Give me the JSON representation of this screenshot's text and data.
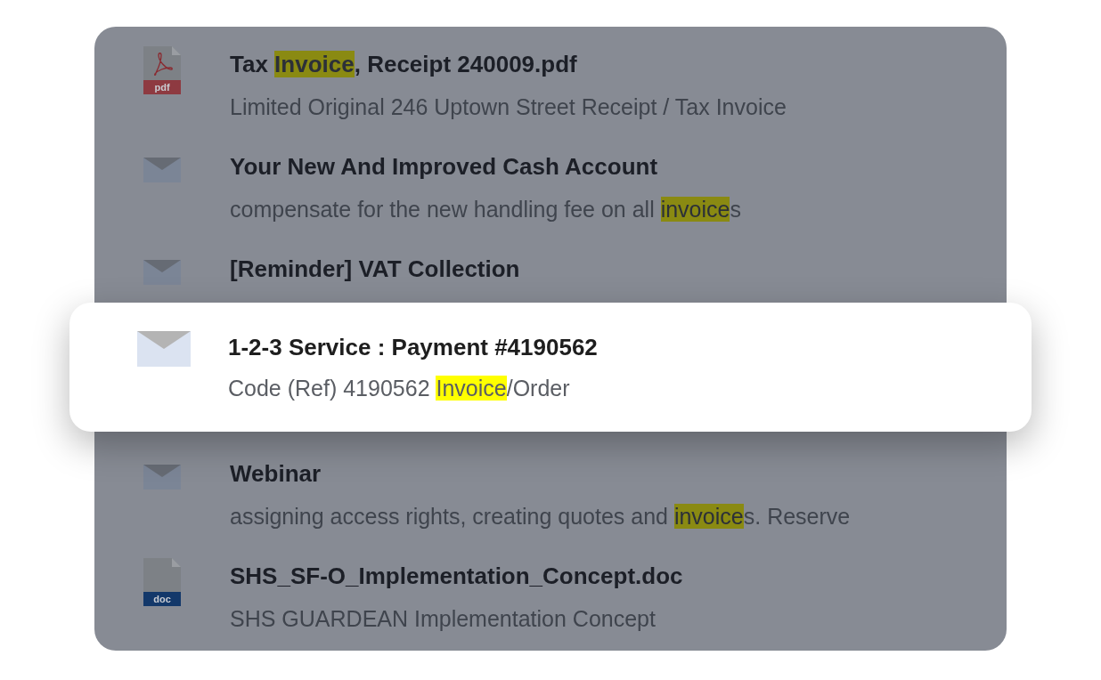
{
  "results": [
    {
      "kind": "pdf",
      "badge": "pdf",
      "title": [
        {
          "text": "Tax "
        },
        {
          "text": "Invoice",
          "highlighted": true
        },
        {
          "text": ", Receipt 240009.pdf"
        }
      ],
      "snippet": [
        {
          "text": "Limited Original 246 Uptown Street Receipt / Tax Invoice"
        }
      ]
    },
    {
      "kind": "mail",
      "title": [
        {
          "text": "Your New And Improved Cash Account"
        }
      ],
      "snippet": [
        {
          "text": "compensate for the new handling fee on all "
        },
        {
          "text": "invoice",
          "highlighted": true
        },
        {
          "text": "s"
        }
      ]
    },
    {
      "kind": "mail",
      "title": [
        {
          "text": "[Reminder] VAT Collection"
        }
      ]
    },
    {
      "kind": "mail",
      "selected": true,
      "title": [
        {
          "text": "1-2-3 Service : Payment #4190562"
        }
      ],
      "snippet": [
        {
          "text": "Code (Ref) 4190562 "
        },
        {
          "text": "Invoice",
          "highlighted": true
        },
        {
          "text": "/Order"
        }
      ]
    },
    {
      "kind": "mail",
      "title": [
        {
          "text": "Webinar"
        }
      ],
      "snippet": [
        {
          "text": "assigning access rights, creating quotes and "
        },
        {
          "text": "invoice",
          "highlighted": true
        },
        {
          "text": "s. Reserve"
        }
      ]
    },
    {
      "kind": "doc",
      "badge": "doc",
      "title": [
        {
          "text": "SHS_SF-O_Implementation_Concept.doc"
        }
      ],
      "snippet": [
        {
          "text": "SHS GUARDEAN Implementation Concept"
        }
      ]
    }
  ]
}
